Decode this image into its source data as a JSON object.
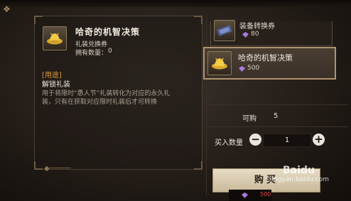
{
  "detail": {
    "item_name": "哈奇的机智决策",
    "item_type": "礼装兑换券",
    "owned_label": "拥有数量：",
    "owned_value": "0",
    "usage_heading": "[用途]",
    "usage_title": "解锁礼装",
    "description": "用于将限时“愚人节”礼装转化为对应的永久礼装，只有在获取对应限时礼装后才可转换"
  },
  "shop_list": {
    "items": [
      {
        "name": "装备转换券",
        "price": "80",
        "icon": "ticket-icon"
      },
      {
        "name": "哈奇的机智决策",
        "price": "500",
        "icon": "golden-hat-icon",
        "selected": true
      }
    ]
  },
  "purchase": {
    "buyable_label": "可购",
    "buyable_value": "5",
    "quantity_label": "买入数量",
    "quantity_value": "1",
    "minus": "−",
    "plus": "+",
    "buy_label": "购买",
    "total_price": "500"
  },
  "watermark": {
    "logo": "Baidu",
    "url": "jingyan.baidu.com"
  },
  "colors": {
    "accent": "#d89a3a",
    "gem": "#a77be0",
    "price_alert": "#e04848",
    "button": "#e7dcc6"
  }
}
